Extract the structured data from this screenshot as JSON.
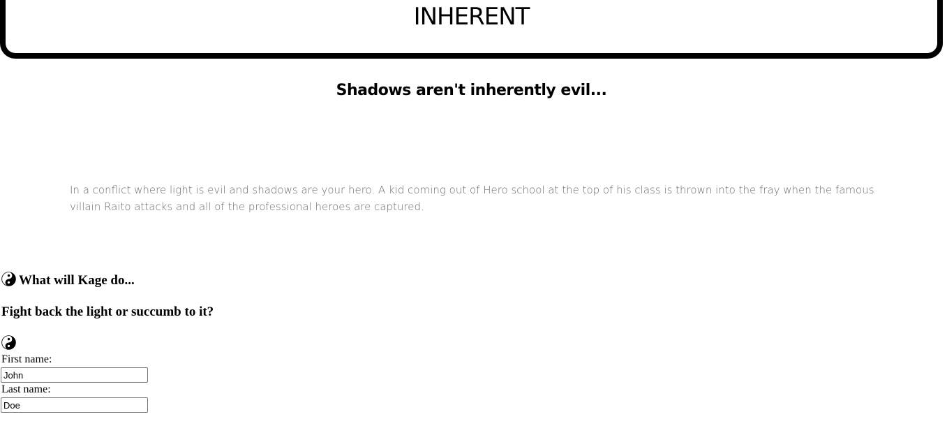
{
  "header": {
    "title": "INHERENT"
  },
  "hero": {
    "subtitle": "Shadows aren't inherently evil...",
    "description": "In a conflict where light is evil and shadows are your hero. A kid coming out of Hero school at the top of his class is thrown into the fray when the famous villain Raito attacks and all of the professional heroes are captured."
  },
  "section": {
    "question": "What will Kage do...",
    "subquestion": "Fight back the light or succumb to it?"
  },
  "form": {
    "first_name_label": "First name:",
    "first_name_value": "John",
    "last_name_label": "Last name:",
    "last_name_value": "Doe"
  },
  "icons": {
    "yin_yang": "yin-yang-icon"
  }
}
